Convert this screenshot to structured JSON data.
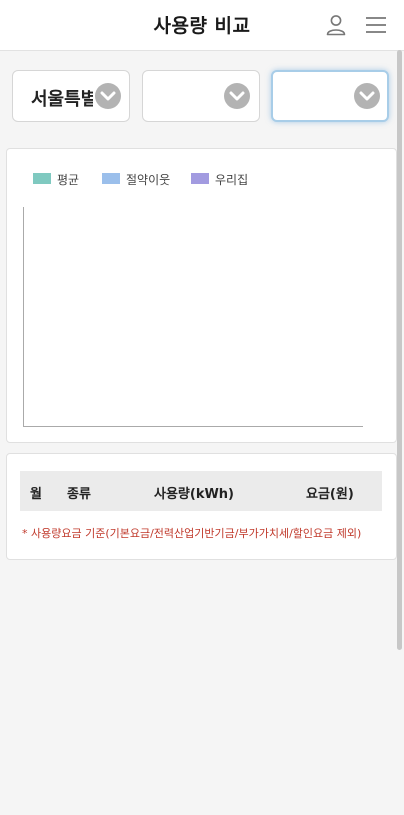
{
  "header": {
    "title": "사용량 비교"
  },
  "filters": {
    "region_value": "서울특별시",
    "district_value": "",
    "dong_value": ""
  },
  "legend": [
    {
      "label": "평균",
      "color": "#7fc9c0"
    },
    {
      "label": "절약이웃",
      "color": "#9bbfeb"
    },
    {
      "label": "우리집",
      "color": "#a29be0"
    }
  ],
  "table": {
    "headers": {
      "month": "월",
      "type": "종류",
      "usage": "사용량(kWh)",
      "charge": "요금(원)"
    },
    "rows": []
  },
  "note": "* 사용량요금 기준(기본요금/전력산업기반기금/부가가치세/할인요금 제외)",
  "colors": {
    "note": "#c0392b",
    "focus_border": "#a8cde8"
  },
  "icons": {
    "user": "user-icon",
    "menu": "menu-icon",
    "dropdown": "chevron-down-icon"
  }
}
